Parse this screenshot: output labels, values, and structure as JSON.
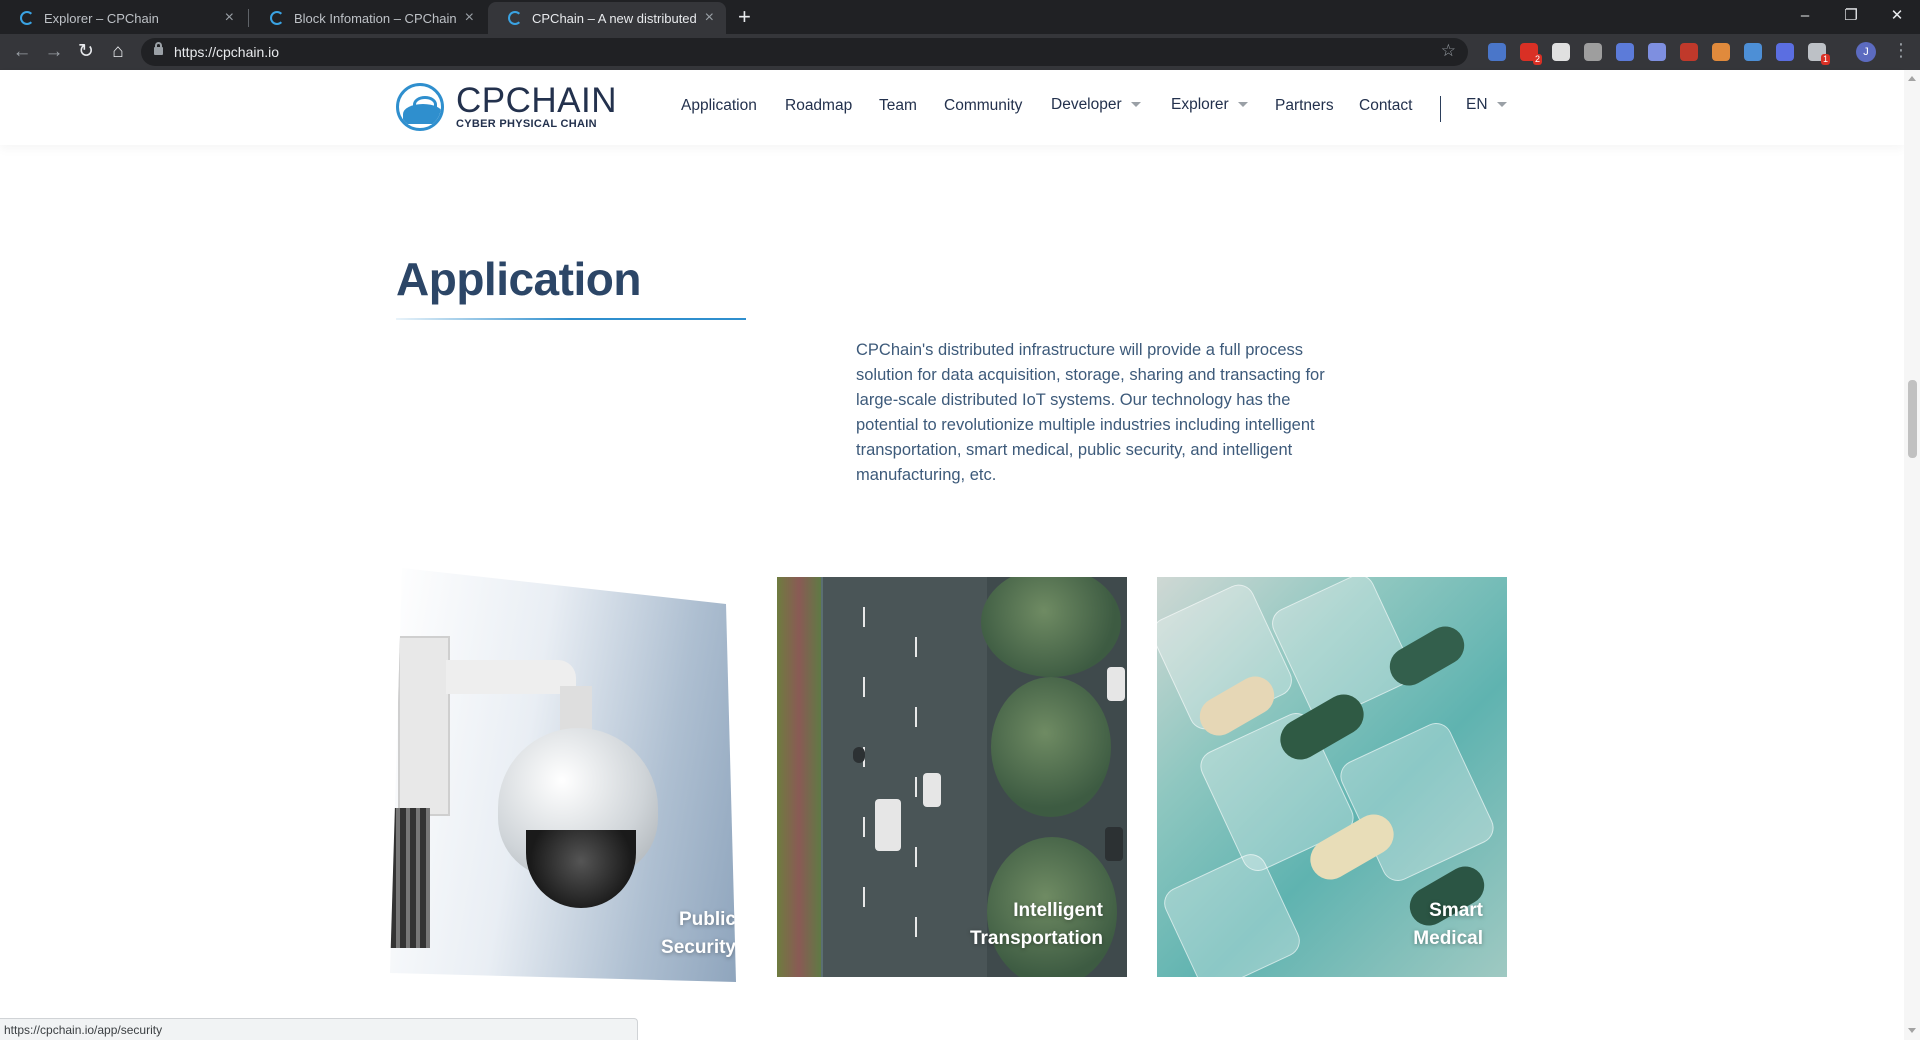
{
  "browser": {
    "tabs": [
      {
        "title": "Explorer – CPChain",
        "close": "×"
      },
      {
        "title": "Block Infomation – CPChain",
        "close": "×"
      },
      {
        "title": "CPChain – A new distributed i",
        "close": "×"
      }
    ],
    "new_tab": "+",
    "window_controls": {
      "minimize": "–",
      "restore": "❐",
      "close": "✕"
    },
    "nav": {
      "back": "←",
      "forward": "→",
      "reload": "↻",
      "home": "⌂"
    },
    "url": "https://cpchain.io",
    "bookmark_icon": "☆",
    "extensions": [
      {
        "name": "translate-icon",
        "color": "#4a76c9"
      },
      {
        "name": "shield-icon",
        "color": "#d93025",
        "badge": "2"
      },
      {
        "name": "panda-icon",
        "color": "#e0e0e0"
      },
      {
        "name": "circle-icon",
        "color": "#9e9e9e"
      },
      {
        "name": "grid-icon",
        "color": "#5c7bd9"
      },
      {
        "name": "flag-icon",
        "color": "#7e8fe0"
      },
      {
        "name": "book-icon",
        "color": "#c0392b"
      },
      {
        "name": "owl-icon",
        "color": "#e08a3c"
      },
      {
        "name": "disc-icon",
        "color": "#4d8fd6"
      },
      {
        "name": "hexagon-icon",
        "color": "#5b6ee1"
      },
      {
        "name": "cast-icon",
        "color": "#bdc1c6",
        "badge": "1"
      }
    ],
    "profile_initial": "J",
    "menu": "⋮",
    "status_url": "https://cpchain.io/app/security"
  },
  "site": {
    "logo": {
      "name": "CPCHAIN",
      "tagline": "CYBER PHYSICAL CHAIN"
    },
    "nav": [
      {
        "label": "Application",
        "dropdown": false
      },
      {
        "label": "Roadmap",
        "dropdown": false
      },
      {
        "label": "Team",
        "dropdown": false
      },
      {
        "label": "Community",
        "dropdown": false
      },
      {
        "label": "Developer",
        "dropdown": true
      },
      {
        "label": "Explorer",
        "dropdown": true
      },
      {
        "label": "Partners",
        "dropdown": false
      },
      {
        "label": "Contact",
        "dropdown": false
      }
    ],
    "language": "EN",
    "accent_color": "#2f8fce"
  },
  "section": {
    "title": "Application",
    "description": "CPChain's distributed infrastructure will provide a full process solution for data acquisition, storage, sharing and transacting for large-scale distributed IoT systems. Our technology has the potential to revolutionize multiple industries including intelligent transportation, smart medical, public security, and intelligent manufacturing, etc.",
    "cards": [
      {
        "line1": "Public",
        "line2": "Security"
      },
      {
        "line1": "Intelligent",
        "line2": "Transportation"
      },
      {
        "line1": "Smart",
        "line2": "Medical"
      }
    ]
  }
}
